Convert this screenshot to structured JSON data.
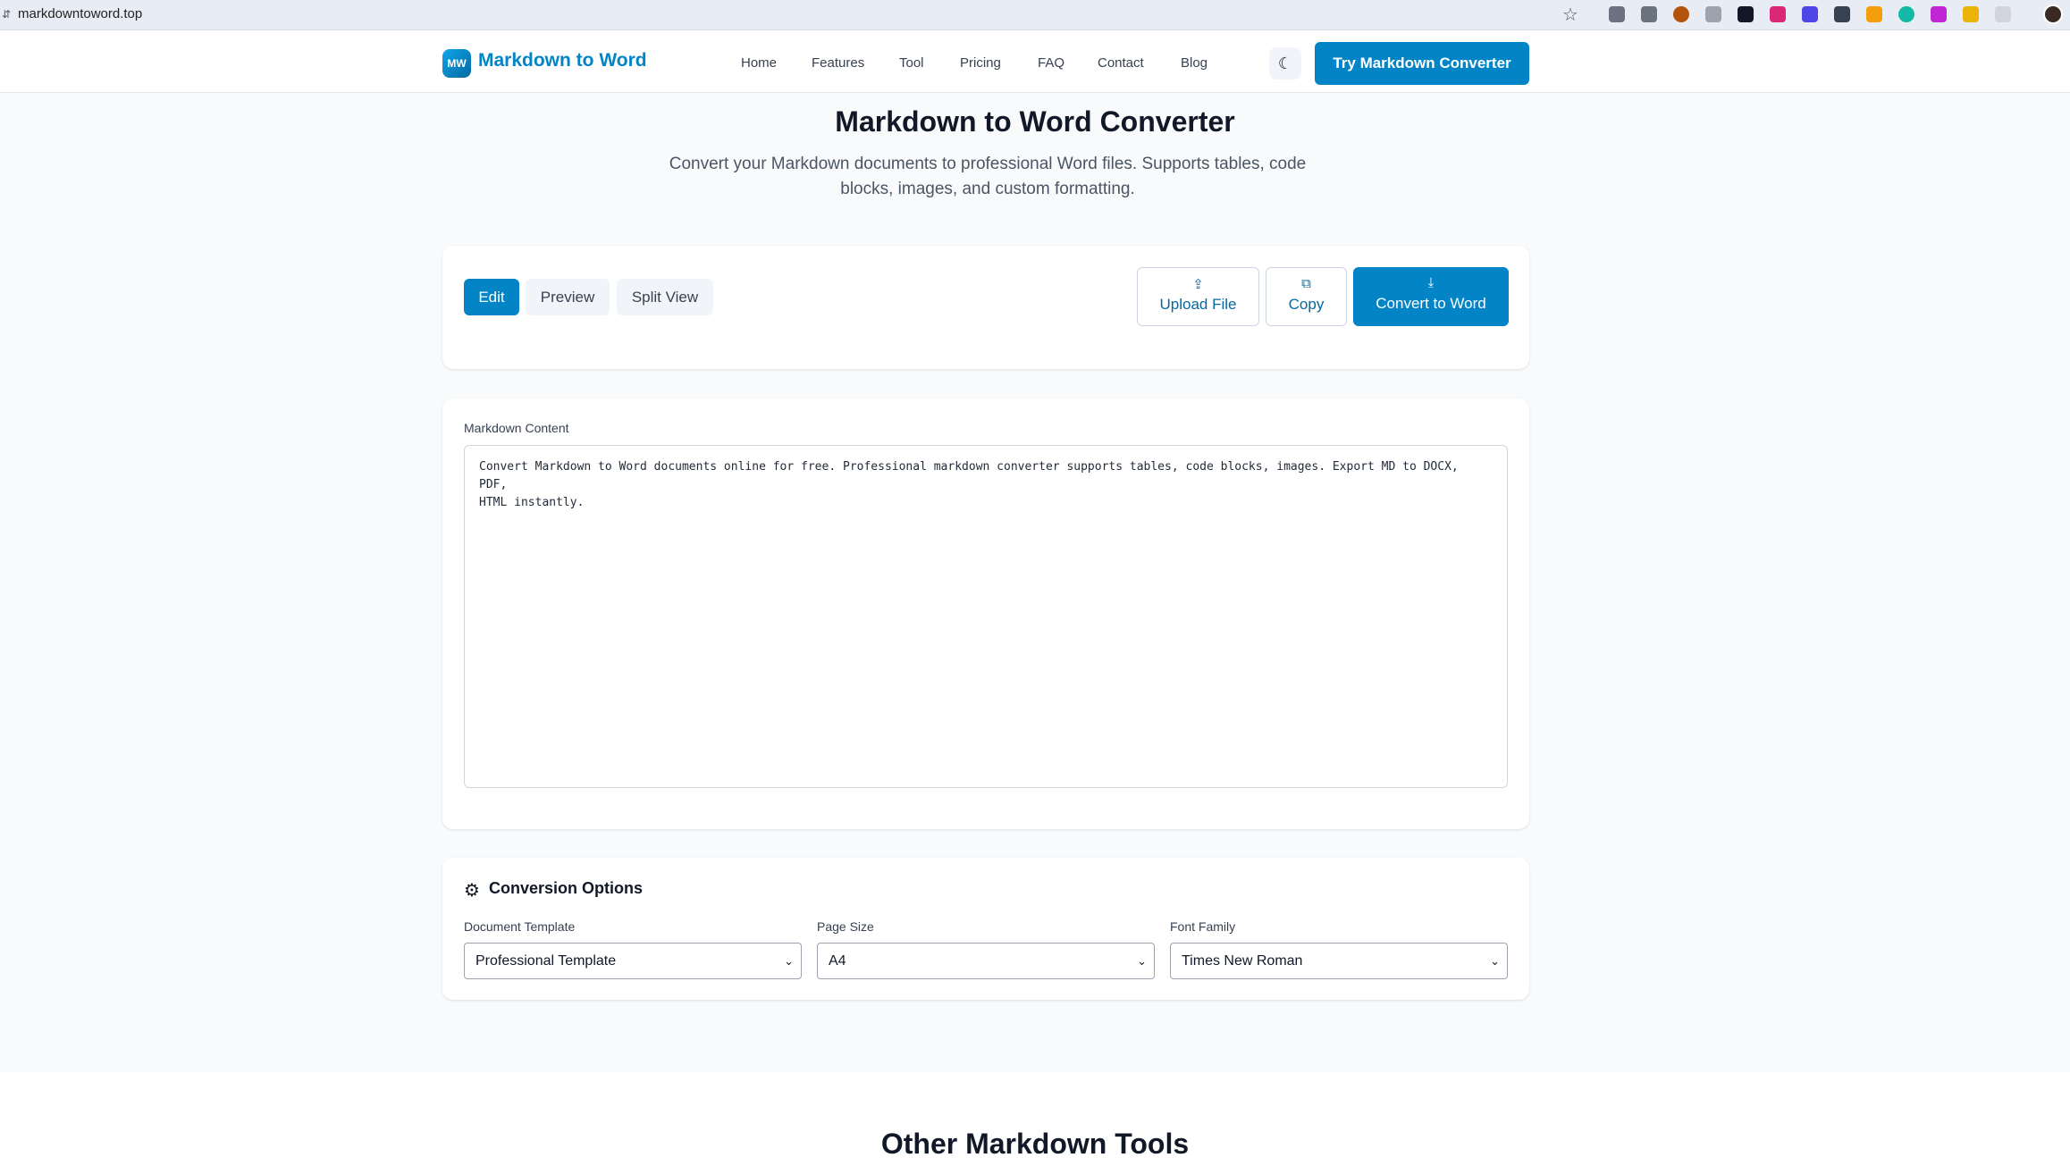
{
  "browser": {
    "url": "markdowntoword.top"
  },
  "header": {
    "logo_badge": "MW",
    "logo_text": "Markdown to Word",
    "nav": [
      "Home",
      "Features",
      "Tool",
      "Pricing",
      "FAQ",
      "Contact",
      "Blog"
    ],
    "cta": "Try Markdown Converter"
  },
  "hero": {
    "title": "Markdown to Word Converter",
    "subtitle": "Convert your Markdown documents to professional Word files. Supports tables, code blocks, images, and custom formatting."
  },
  "toolbar": {
    "modes": [
      "Edit",
      "Preview",
      "Split View"
    ],
    "active_mode": "Edit",
    "upload_label": "Upload File",
    "copy_label": "Copy",
    "convert_label": "Convert to Word"
  },
  "editor": {
    "label": "Markdown Content",
    "content": "Convert Markdown to Word documents online for free. Professional markdown converter supports tables, code blocks, images. Export MD to DOCX, PDF,\nHTML instantly."
  },
  "options": {
    "title": "Conversion Options",
    "template_label": "Document Template",
    "template_value": "Professional Template",
    "page_size_label": "Page Size",
    "page_size_value": "A4",
    "font_label": "Font Family",
    "font_value": "Times New Roman"
  },
  "next_section": {
    "title": "Other Markdown Tools"
  },
  "colors": {
    "primary": "#0284c7",
    "background": "#f8fafc"
  }
}
